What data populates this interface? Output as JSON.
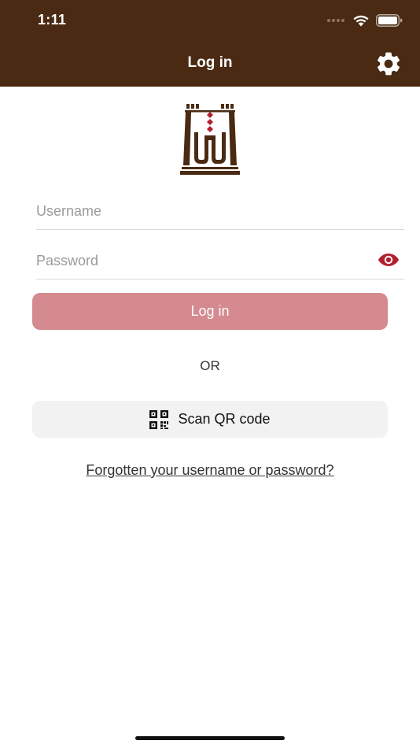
{
  "status_bar": {
    "time": "1:11"
  },
  "header": {
    "title": "Log in",
    "background_color": "#4a2a12",
    "settings_icon": "gear-icon"
  },
  "form": {
    "username_placeholder": "Username",
    "password_placeholder": "Password",
    "password_toggle_icon": "eye-icon",
    "login_button_label": "Log in",
    "login_button_color": "#d48a8f",
    "or_label": "OR",
    "scan_qr_label": "Scan QR code",
    "scan_qr_icon": "qr-code-icon",
    "forgot_link": "Forgotten your username or password?"
  },
  "colors": {
    "accent": "#b0202e",
    "brand_brown": "#4a2a12"
  }
}
